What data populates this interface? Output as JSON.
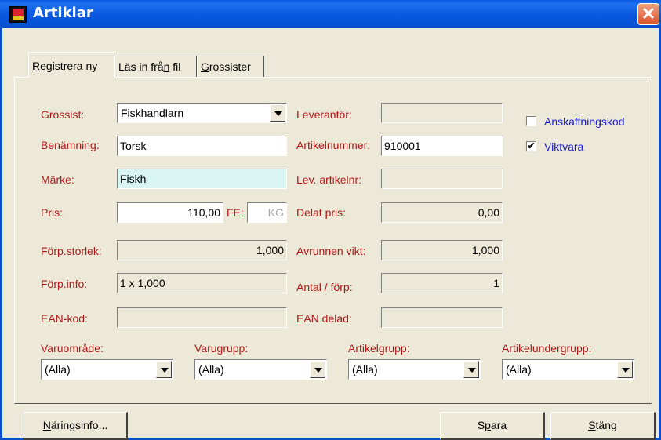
{
  "window": {
    "title": "Artiklar",
    "close_glyph": "✕"
  },
  "tabs": [
    {
      "label": "Registrera ny",
      "hotkey": "R",
      "rest": "egistrera ny"
    },
    {
      "label": "Läs in från fil",
      "pre": "Läs in frå",
      "hotkey": "n",
      "post": " fil"
    },
    {
      "label": "Grossister",
      "hotkey": "G",
      "rest": "rossister"
    }
  ],
  "form": {
    "grossist": {
      "label": "Grossist:",
      "value": "Fiskhandlarn"
    },
    "benamning": {
      "label": "Benämning:",
      "value": "Torsk"
    },
    "marke": {
      "label": "Märke:",
      "value": "Fiskh"
    },
    "pris": {
      "label": "Pris:",
      "value": "110,00"
    },
    "fe": {
      "label": "FE:",
      "value": "KG"
    },
    "forp_storlek": {
      "label": "Förp.storlek:",
      "value": "1,000"
    },
    "forp_info": {
      "label": "Förp.info:",
      "value": "1 x 1,000"
    },
    "ean_kod": {
      "label": "EAN-kod:",
      "value": ""
    },
    "leverantor": {
      "label": "Leverantör:",
      "value": ""
    },
    "artikelnummer": {
      "label": "Artikelnummer:",
      "value": "910001"
    },
    "lev_artikelnr": {
      "label": "Lev. artikelnr:",
      "value": ""
    },
    "delat_pris": {
      "label": "Delat pris:",
      "value": "0,00"
    },
    "avrunnen_vikt": {
      "label": "Avrunnen vikt:",
      "value": "1,000"
    },
    "antal_forp": {
      "label": "Antal / förp:",
      "value": "1"
    },
    "ean_delad": {
      "label": "EAN delad:",
      "value": ""
    },
    "anskaffningskod": {
      "label": "Anskaffningskod",
      "checked": false
    },
    "viktvara": {
      "label": "Viktvara",
      "checked": true,
      "mark": "✔"
    }
  },
  "filters": [
    {
      "label": "Varuområde:",
      "value": "(Alla)"
    },
    {
      "label": "Varugrupp:",
      "value": "(Alla)"
    },
    {
      "label": "Artikelgrupp:",
      "value": "(Alla)"
    },
    {
      "label": "Artikelundergrupp:",
      "value": "(Alla)"
    }
  ],
  "buttons": {
    "naringsinfo": {
      "label": "Näringsinfo...",
      "hotkey": "N",
      "rest": "äringsinfo..."
    },
    "spara": {
      "label": "Spara",
      "pre": "S",
      "hotkey": "p",
      "post": "ara"
    },
    "stang": {
      "label": "Stäng",
      "hotkey": "S",
      "rest": "täng"
    }
  },
  "colors": {
    "titlebar": "#0A59E0",
    "label_red": "#B01818",
    "label_blue": "#1A1AD0",
    "marke_bg": "#D8F5F2"
  }
}
